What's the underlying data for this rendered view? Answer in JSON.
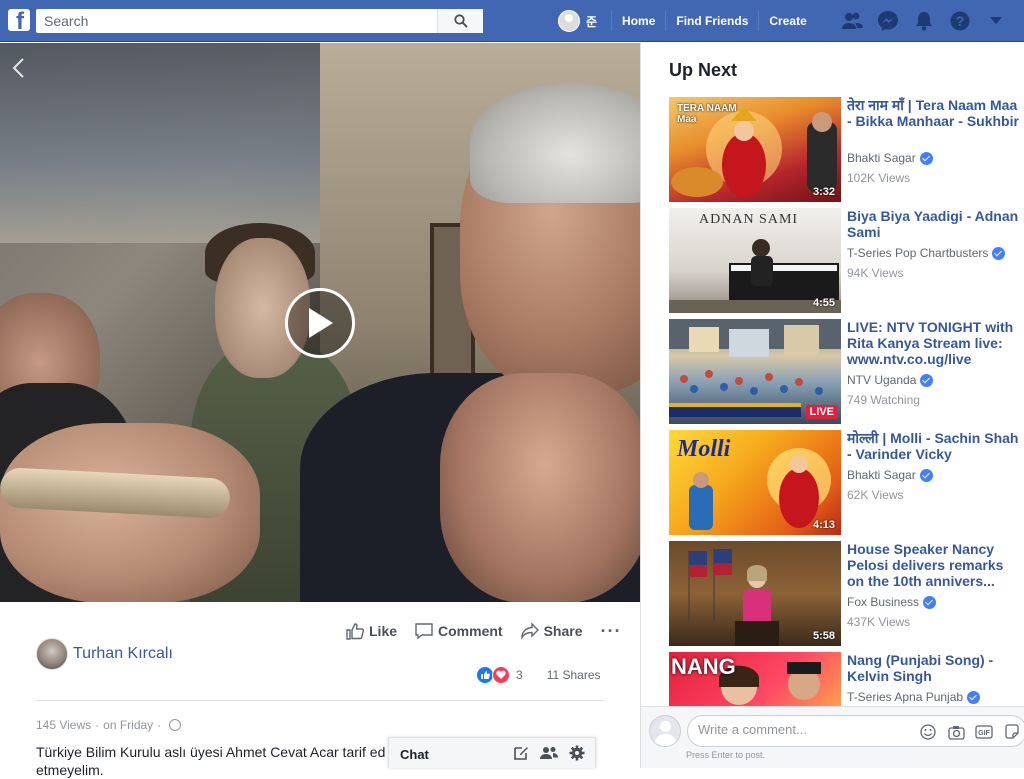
{
  "topbar": {
    "search_placeholder": "Search",
    "user_name": "준",
    "nav_links": [
      "Home",
      "Find Friends",
      "Create"
    ]
  },
  "icons": {
    "logo": "facebook-logo-icon",
    "search": "search-icon",
    "friends": "friend-requests-icon",
    "messenger": "messenger-icon",
    "notifications": "bell-icon",
    "help": "help-icon",
    "menu": "caret-down-icon"
  },
  "colors": {
    "brand": "#4267b2",
    "link": "#365899",
    "like": "#1877f2",
    "love": "#f33e58",
    "live": "#e41e3f"
  },
  "post": {
    "author": "Turhan Kırcalı",
    "actions": {
      "like": "Like",
      "comment": "Comment",
      "share": "Share",
      "more": "···"
    },
    "reaction_count": "3",
    "shares": "11 Shares",
    "views": "145 Views",
    "dot": "·",
    "date": "on Friday",
    "description": "Türkiye Bilim Kurulu aslı üyesi Ahmet Cevat Acar tarif ed uygulanabileceği bir formül. İnşâl etmeyelim."
  },
  "chat": {
    "label": "Chat"
  },
  "sidebar": {
    "title": "Up Next",
    "videos": [
      {
        "title": "तेरा नाम माँ | Tera Naam Maa - Bikka Manhaar - Sukhbir",
        "channel": "Bhakti Sagar",
        "verified": true,
        "views": "102K Views",
        "duration": "3:32",
        "thumb_text": "TERA NAAM Maa"
      },
      {
        "title": "Biya Biya Yaadigi - Adnan Sami",
        "channel": "T-Series Pop Chartbusters",
        "verified": true,
        "views": "94K Views",
        "duration": "4:55",
        "thumb_text": "ADNAN SAMI"
      },
      {
        "title": "LIVE: NTV TONIGHT with Rita Kanya Stream live: www.ntv.co.ug/live",
        "channel": "NTV Uganda",
        "verified": true,
        "views": "749 Watching",
        "duration": "LIVE",
        "thumb_text": ""
      },
      {
        "title": "मोल्ली | Molli - Sachin Shah - Varinder Vicky",
        "channel": "Bhakti Sagar",
        "verified": true,
        "views": "62K Views",
        "duration": "4:13",
        "thumb_text": "Molli"
      },
      {
        "title": "House Speaker Nancy Pelosi delivers remarks on the 10th annivers...",
        "channel": "Fox Business",
        "verified": true,
        "views": "437K Views",
        "duration": "5:58",
        "thumb_text": ""
      },
      {
        "title": "Nang (Punjabi Song) - Kelvin Singh",
        "channel": "T-Series Apna Punjab",
        "verified": true,
        "views": "",
        "duration": "",
        "thumb_text": "NANG"
      }
    ]
  },
  "composer": {
    "placeholder": "Write a comment...",
    "hint": "Press Enter to post."
  }
}
